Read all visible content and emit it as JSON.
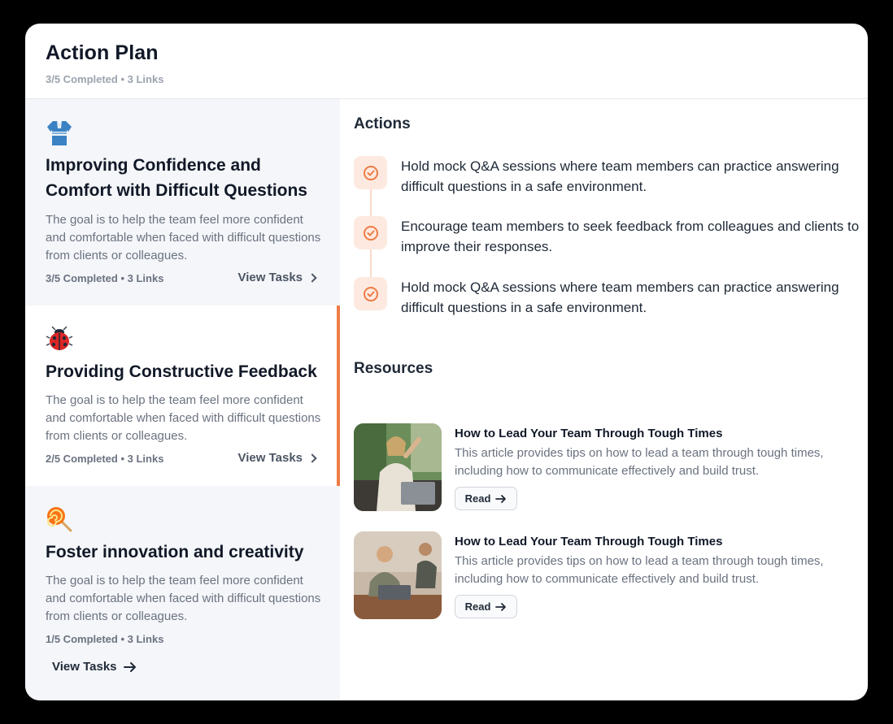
{
  "header": {
    "title": "Action Plan",
    "subtitle": "3/5 Completed • 3 Links"
  },
  "goals": [
    {
      "icon": "kimono-icon",
      "title": "Improving Confidence and Comfort with Difficult Questions",
      "description": "The goal is to help the team feel more confident and comfortable when faced with difficult questions from clients or colleagues.",
      "meta": "3/5 Completed • 3 Links",
      "view_label": "View Tasks",
      "active": false
    },
    {
      "icon": "ladybug-icon",
      "title": "Providing Constructive Feedback",
      "description": "The goal is to help the team feel more confident and comfortable when faced with difficult questions from clients or colleagues.",
      "meta": "2/5 Completed • 3 Links",
      "view_label": "View Tasks",
      "active": true
    },
    {
      "icon": "lollipop-icon",
      "title": "Foster innovation and creativity",
      "description": "The goal is to help the team feel more confident and comfortable when faced with difficult questions from clients or colleagues.",
      "meta": "1/5 Completed • 3 Links",
      "view_label": "View Tasks",
      "active": false
    }
  ],
  "actions": {
    "title": "Actions",
    "items": [
      "Hold mock Q&A sessions where team members can practice answering difficult questions in a safe environment.",
      "Encourage team members to seek feedback from colleagues and clients to improve their responses.",
      "Hold mock Q&A sessions where team members can practice answering difficult questions in a safe environment."
    ]
  },
  "resources": {
    "title": "Resources",
    "items": [
      {
        "title": "How to Lead Your Team Through Tough Times",
        "description": "This article provides tips on how to lead a team through tough times, including how to communicate effectively and build trust.",
        "button_label": "Read"
      },
      {
        "title": "How to Lead Your Team Through Tough Times",
        "description": "This article provides tips on how to lead a team through tough times, including how to communicate effectively and build trust.",
        "button_label": "Read"
      }
    ]
  },
  "colors": {
    "accent": "#ee7b45",
    "accent_soft": "#fde9df",
    "panel_bg": "#f4f6f9"
  }
}
